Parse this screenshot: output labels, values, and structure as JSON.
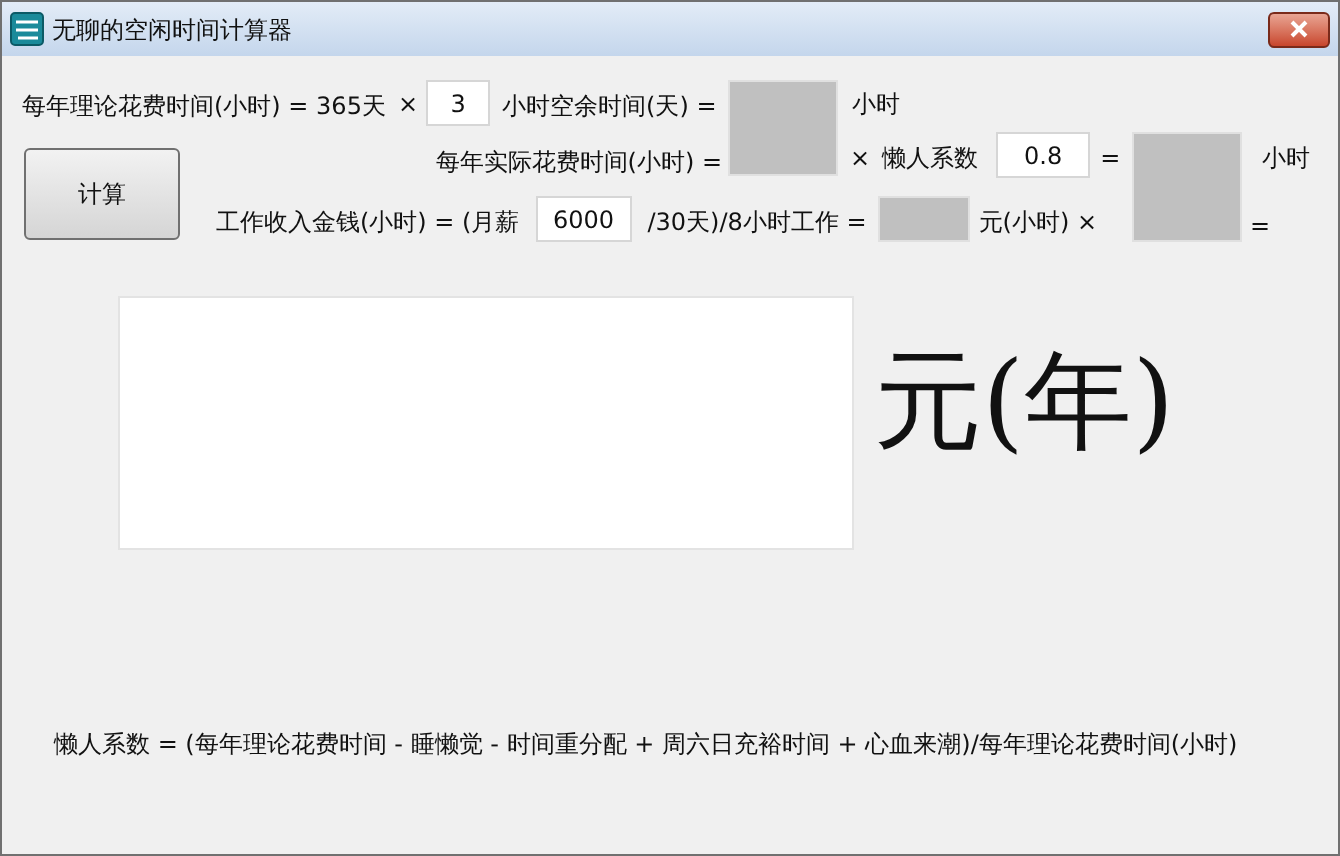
{
  "window": {
    "title": "无聊的空闲时间计算器"
  },
  "theory_row": {
    "label": "每年理论花费时间(小时) = 365天",
    "times": "×",
    "hours_value": "3",
    "label_2": "小时空余时间(天) =",
    "unit": "小时"
  },
  "calculate_button": "计算",
  "actual_row": {
    "label": "每年实际花费时间(小时) =",
    "times": "×",
    "factor_label": "懒人系数",
    "factor_value": "0.8",
    "equals": "=",
    "unit": "小时"
  },
  "income_row": {
    "label": "工作收入金钱(小时) = (月薪",
    "salary_value": "6000",
    "label_2": "/30天)/8小时工作 =",
    "unit": "元(小时) ×",
    "equals": "="
  },
  "result_unit": "元(年)",
  "footnote": "懒人系数 = (每年理论花费时间 - 睡懒觉 - 时间重分配 + 周六日充裕时间 + 心血来潮)/每年理论花费时间(小时)"
}
